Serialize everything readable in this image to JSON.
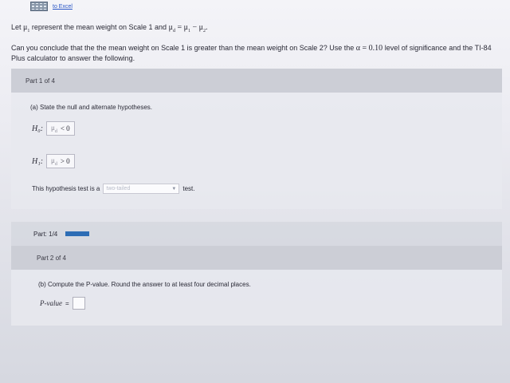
{
  "excel": {
    "link_label": "to Excel"
  },
  "intro": {
    "line1_prefix": "Let",
    "line1_mid": "represent the mean weight on Scale 1 and",
    "mu": "μ",
    "sub1": "1",
    "sub2": "2",
    "subd": "d",
    "eq": "=",
    "minus": "−",
    "dot": ".",
    "line2_prefix": "Can you conclude that the the mean weight on Scale 1 is greater than the mean weight on Scale 2? Use the",
    "alpha_expr": "α = 0.10",
    "line2_suffix": "level of significance and the TI-84 Plus calculator to answer the following."
  },
  "part1": {
    "header": "Part 1 of 4",
    "subquestion": "(a) State the null and alternate hypotheses.",
    "h0_label": "H₀:",
    "h0_op": "< 0",
    "h1_label": "H₁:",
    "h1_op": "> 0",
    "test_prefix": "This hypothesis test is a",
    "test_select_value": "two-tailed",
    "test_suffix": "test."
  },
  "progress": {
    "label": "Part: 1/4",
    "fraction": 0.25
  },
  "part2": {
    "header": "Part 2 of 4",
    "subquestion": "(b) Compute the P-value. Round the answer to at least four decimal places.",
    "pvalue_label": "P-value",
    "pvalue_eq": "=",
    "pvalue_value": ""
  },
  "colors": {
    "accent": "#2d6db5",
    "link": "#2a56c6"
  },
  "icons": {
    "excel": "spreadsheet-icon",
    "dropdown": "dropdown-arrow-icon"
  }
}
